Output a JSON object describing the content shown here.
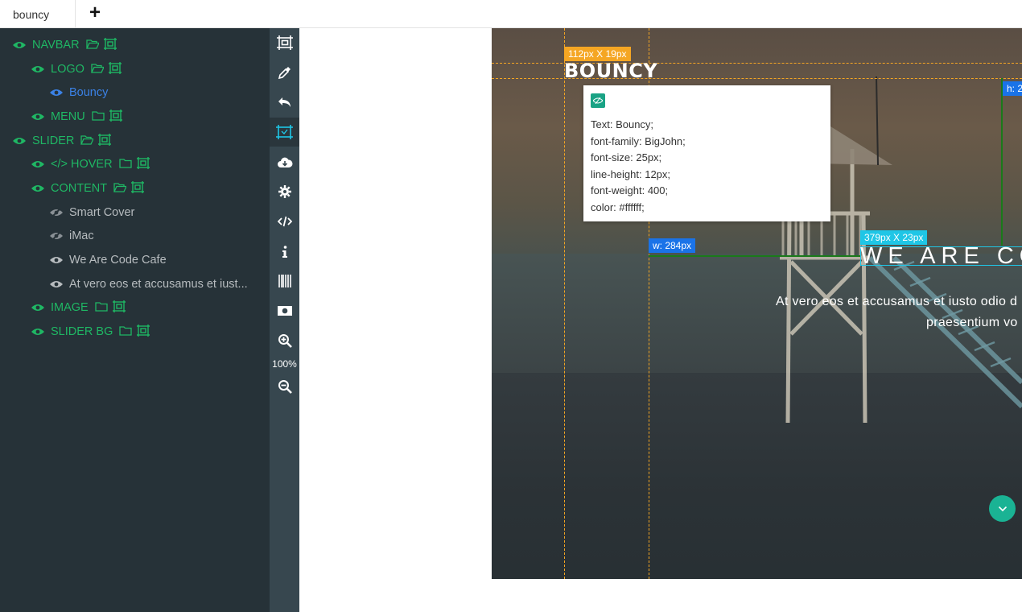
{
  "tabs": {
    "active": "bouncy",
    "add": "+"
  },
  "layers": [
    {
      "label": "NAVBAR",
      "level": 0,
      "state": "green",
      "folder": "open"
    },
    {
      "label": "LOGO",
      "level": 1,
      "state": "green",
      "folder": "open"
    },
    {
      "label": "Bouncy",
      "level": 2,
      "state": "blue"
    },
    {
      "label": "MENU",
      "level": 1,
      "state": "green",
      "folder": "closed"
    },
    {
      "label": "SLIDER",
      "level": 0,
      "state": "green",
      "folder": "open"
    },
    {
      "label": "</> HOVER",
      "level": 1,
      "state": "green",
      "folder": "closed"
    },
    {
      "label": "CONTENT",
      "level": 1,
      "state": "green",
      "folder": "open"
    },
    {
      "label": "Smart Cover",
      "level": 2,
      "state": "grey-hidden"
    },
    {
      "label": "iMac",
      "level": 2,
      "state": "grey-hidden"
    },
    {
      "label": "We Are Code Cafe",
      "level": 2,
      "state": "grey"
    },
    {
      "label": "At vero eos et accusamus et iust...",
      "level": 2,
      "state": "grey"
    },
    {
      "label": "IMAGE",
      "level": 1,
      "state": "green",
      "folder": "closed"
    },
    {
      "label": "SLIDER BG",
      "level": 1,
      "state": "green",
      "folder": "closed"
    }
  ],
  "toolbar": {
    "items": [
      "select-frame-icon",
      "eyedropper-icon",
      "undo-icon",
      "measure-icon",
      "cloud-download-icon",
      "settings-icon",
      "code-icon",
      "info-icon",
      "barcode-icon",
      "money-icon",
      "zoom-in-icon",
      "zoom-out-icon"
    ],
    "zoom_level": "100%"
  },
  "canvas": {
    "brand": "BOUNCY",
    "headline": "WE ARE CO",
    "sub1": "At vero eos et accusamus et iusto odio d",
    "sub2": "praesentium vo",
    "badges": {
      "logo_size": "112px X 19px",
      "width_measure": "w: 284px",
      "headline_size": "379px X 23px",
      "height_measure": "h: 2"
    }
  },
  "tooltip": {
    "lines": [
      "Text: Bouncy;",
      "font-family: BigJohn;",
      "font-size: 25px;",
      "line-height: 12px;",
      "font-weight: 400;",
      "color: #ffffff;"
    ]
  },
  "colors": {
    "panel_bg": "#263238",
    "toolbar_bg": "#37474f",
    "layer_green": "#1fb764",
    "layer_blue": "#3b82e6",
    "guide_orange": "#f5a623",
    "accent_teal": "#1ab394"
  }
}
